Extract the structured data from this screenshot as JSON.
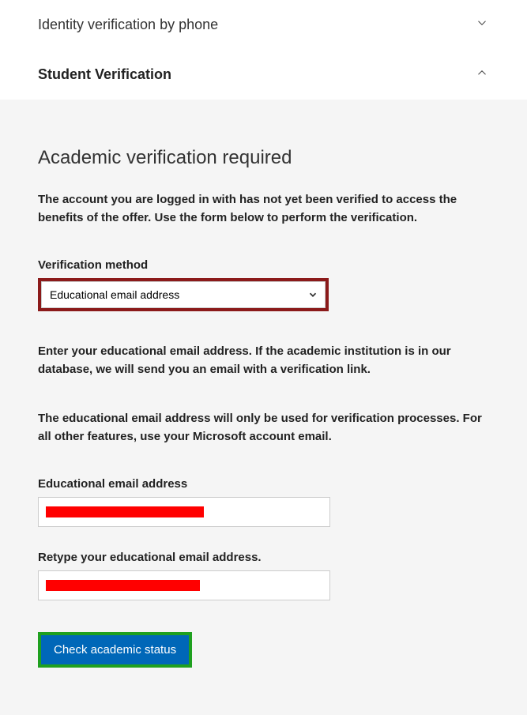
{
  "accordion": {
    "item1": {
      "title": "Identity verification by phone"
    },
    "item2": {
      "title": "Student Verification"
    }
  },
  "panel": {
    "heading": "Academic verification required",
    "description": "The account you are logged in with has not yet been verified to access the benefits of the offer. Use the form below to perform the verification.",
    "method_label": "Verification method",
    "method_value": "Educational email address",
    "info1": "Enter your educational email address. If the academic institution is in our database, we will send you an email with a verification link.",
    "info2": "The educational email address will only be used for verification processes. For all other features, use your Microsoft account email.",
    "email_label": "Educational email address",
    "retype_label": "Retype your educational email address.",
    "button_label": "Check academic status"
  }
}
